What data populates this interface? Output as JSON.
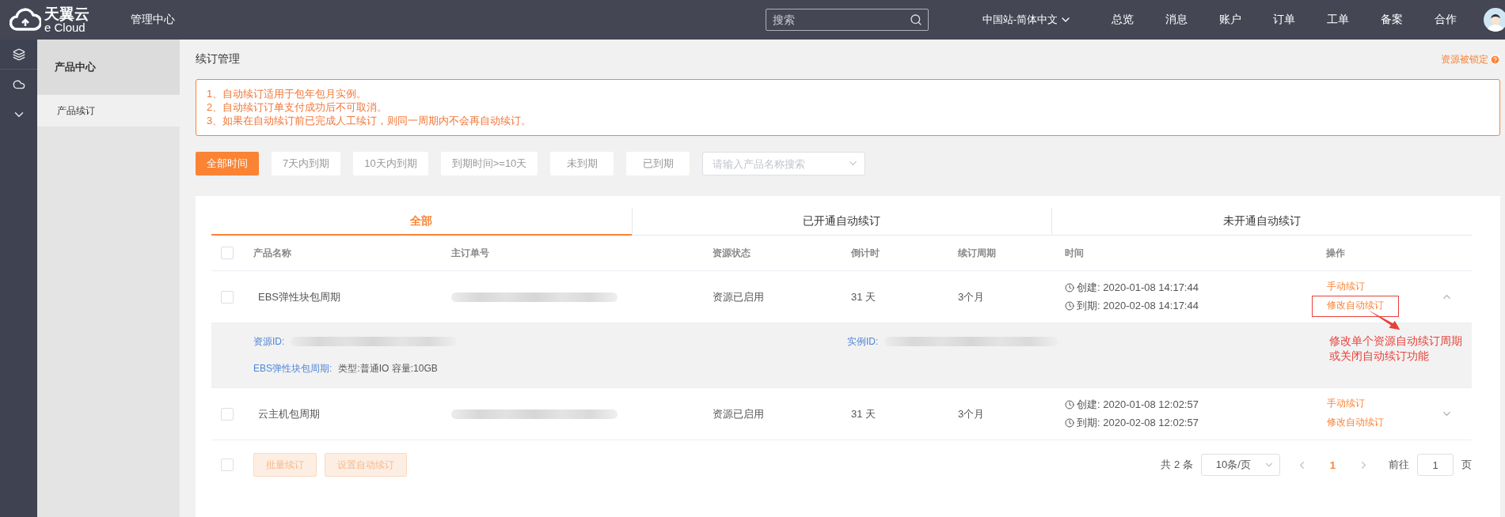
{
  "topbar": {
    "logo_text": "天翼云",
    "logo_subtext": "e Cloud",
    "title": "管理中心",
    "search": {
      "placeholder": "搜索"
    },
    "region": "中国站-简体中文",
    "nav": [
      "总览",
      "消息",
      "账户",
      "订单",
      "工单",
      "备案",
      "合作"
    ]
  },
  "sidebar": {
    "title": "产品中心",
    "items": [
      {
        "label": "产品续订",
        "selected": true
      }
    ]
  },
  "page": {
    "title": "续订管理",
    "lock_link": "资源被锁定"
  },
  "notice": [
    "1、自动续订适用于包年包月实例。",
    "2、自动续订订单支付成功后不可取消。",
    "3、如果在自动续订前已完成人工续订，则同一周期内不会再自动续订。"
  ],
  "filters": [
    {
      "label": "全部时间",
      "selected": true
    },
    {
      "label": "7天内到期",
      "selected": false
    },
    {
      "label": "10天内到期",
      "selected": false
    },
    {
      "label": "到期时间>=10天",
      "selected": false
    },
    {
      "label": "未到期",
      "selected": false
    },
    {
      "label": "已到期",
      "selected": false
    }
  ],
  "product_search": {
    "placeholder": "请输入产品名称搜索"
  },
  "tabs": [
    {
      "label": "全部",
      "selected": true
    },
    {
      "label": "已开通自动续订",
      "selected": false
    },
    {
      "label": "未开通自动续订",
      "selected": false
    }
  ],
  "table": {
    "select_all": {
      "checked": false
    },
    "columns": [
      "产品名称",
      "主订单号",
      "资源状态",
      "倒计时",
      "续订周期",
      "时间",
      "操作"
    ],
    "rows": [
      {
        "checked": false,
        "expanded": true,
        "name": "EBS弹性块包周期",
        "status": "资源已启用",
        "countdown": "31 天",
        "period": "3个月",
        "created": "创建: 2020-01-08 14:17:44",
        "expires": "到期: 2020-02-08 14:17:44",
        "actions": [
          {
            "label": "手动续订",
            "annotated": false
          },
          {
            "label": "修改自动续订",
            "annotated": true
          }
        ],
        "detail": {
          "resource_id_label": "资源ID:",
          "instance_id_label": "实例ID:",
          "spec_label": "EBS弹性块包周期:",
          "spec_value": "类型:普通IO 容量:10GB"
        }
      },
      {
        "checked": false,
        "expanded": false,
        "name": "云主机包周期",
        "status": "资源已启用",
        "countdown": "31 天",
        "period": "3个月",
        "created": "创建: 2020-01-08 12:02:57",
        "expires": "到期: 2020-02-08 12:02:57",
        "actions": [
          {
            "label": "手动续订",
            "annotated": false
          },
          {
            "label": "修改自动续订",
            "annotated": false
          }
        ]
      }
    ]
  },
  "annotation": {
    "lines": [
      "修改单个资源自动续订周期",
      "或关闭自动续订功能"
    ]
  },
  "footer": {
    "select_all": {
      "checked": false
    },
    "buttons": [
      "批量续订",
      "设置自动续订"
    ],
    "total": "共 2 条",
    "page_size": "10条/页",
    "pages": [
      {
        "label": "1",
        "selected": true
      }
    ],
    "goto_label": "前往",
    "goto_value": "1",
    "page_suffix": "页"
  }
}
